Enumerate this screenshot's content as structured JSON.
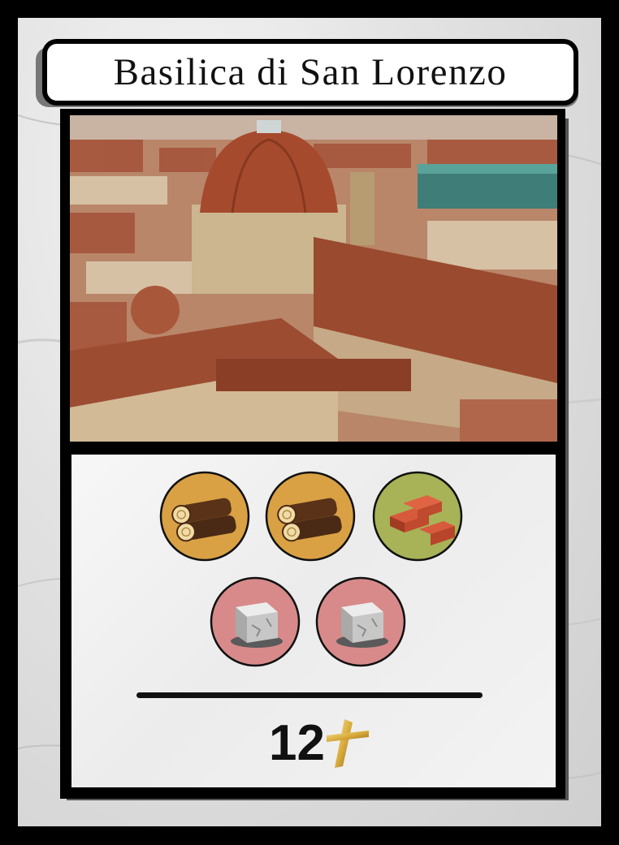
{
  "card": {
    "title": "Basilica di San Lorenzo",
    "cost": [
      {
        "resource": "wood",
        "icon": "wood-logs-icon",
        "color": "#d9a144"
      },
      {
        "resource": "wood",
        "icon": "wood-logs-icon",
        "color": "#d9a144"
      },
      {
        "resource": "brick",
        "icon": "bricks-icon",
        "color": "#a8b257"
      },
      {
        "resource": "stone",
        "icon": "stone-block-icon",
        "color": "#d88a8a"
      },
      {
        "resource": "stone",
        "icon": "stone-block-icon",
        "color": "#d88a8a"
      }
    ],
    "points": "12",
    "points_icon": "gold-cross-icon"
  }
}
